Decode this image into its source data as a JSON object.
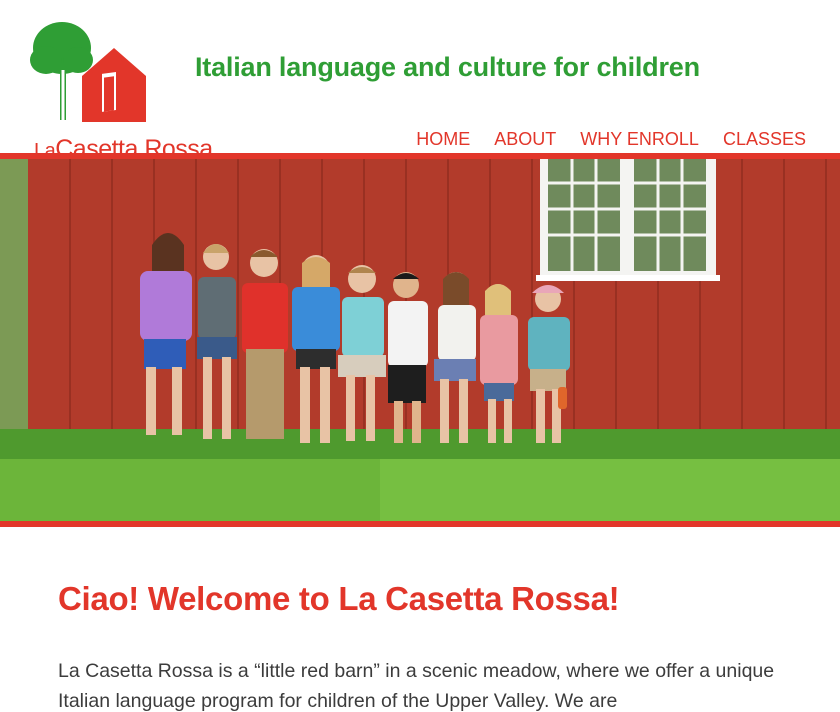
{
  "site": {
    "logo_prefix": "La",
    "logo_name": "Casetta Rossa",
    "tagline": "Italian language and culture for children"
  },
  "nav": {
    "items": [
      {
        "label": "HOME",
        "active": true
      },
      {
        "label": "ABOUT",
        "active": false
      },
      {
        "label": "WHY ENROLL",
        "active": false
      },
      {
        "label": "CLASSES",
        "active": false
      }
    ]
  },
  "main": {
    "heading": "Ciao! Welcome to La Casetta Rossa!",
    "intro": "La Casetta Rossa is a “little red barn” in a scenic meadow, where we offer a unique Italian language program for children of the Upper Valley. We are"
  },
  "colors": {
    "brand_red": "#e2362a",
    "brand_green": "#2f9e35",
    "barn_red": "#b73a2a",
    "grass": "#5ea83a"
  },
  "icons": [
    "tree-icon",
    "red-house-icon"
  ]
}
